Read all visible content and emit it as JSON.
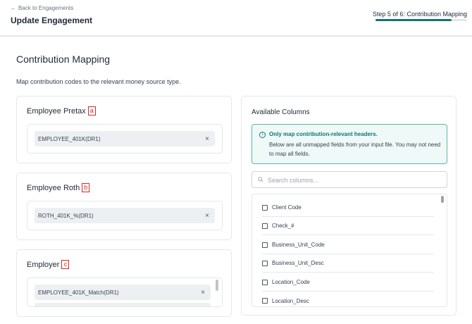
{
  "header": {
    "back_label": "Back to Engagements",
    "title": "Update Engagement",
    "step_label": "Step 5 of 6: Contribution Mapping",
    "progress": 0.833,
    "accent": "#0f766e"
  },
  "main": {
    "title": "Contribution Mapping",
    "description": "Map contribution codes to the relevant money source type."
  },
  "cards": [
    {
      "title": "Employee Pretax",
      "marker": "a",
      "chips": [
        "EMPLOYEE_401K(DR1)"
      ]
    },
    {
      "title": "Employee Roth",
      "marker": "b",
      "chips": [
        "ROTH_401K_%(DR1)"
      ]
    },
    {
      "title": "Employer",
      "marker": "c",
      "chips": [
        "EMPLOYEE_401K_Match(DR1)"
      ]
    }
  ],
  "available": {
    "title": "Available Columns",
    "info_title": "Only map contribution-relevant headers.",
    "info_body": "Below are all unmapped fields from your input file. You may not need to map all fields.",
    "search_placeholder": "Search columns...",
    "columns": [
      "Client Code",
      "Check_#",
      "Business_Unit_Code",
      "Business_Unit_Desc",
      "Location_Code",
      "Location_Desc"
    ]
  },
  "icons": {
    "back": "arrow-left-icon",
    "info": "info-icon",
    "search": "search-icon",
    "remove": "close-icon"
  }
}
